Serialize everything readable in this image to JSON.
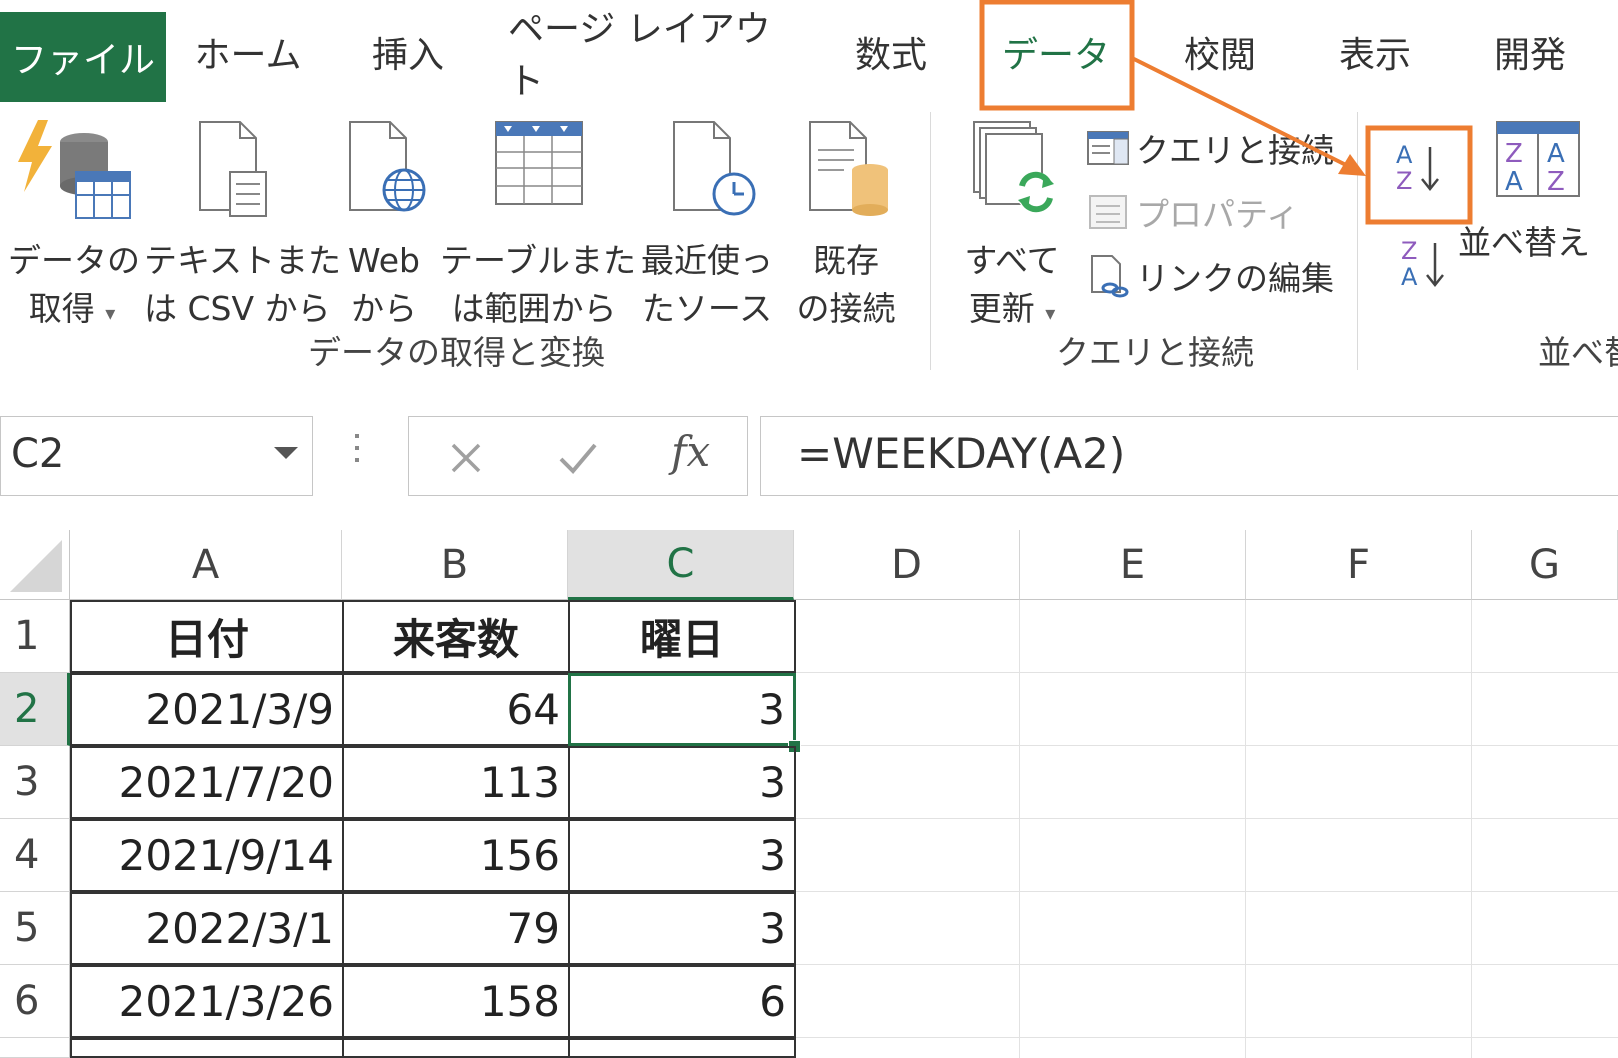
{
  "tabs": [
    "ファイル",
    "ホーム",
    "挿入",
    "ページ レイアウト",
    "数式",
    "データ",
    "校閲",
    "表示",
    "開発"
  ],
  "ribbon": {
    "get_data": {
      "line1": "データの",
      "line2": "取得"
    },
    "text_csv": {
      "line1": "テキストまた",
      "line2": "は CSV から"
    },
    "web": {
      "line1": "Web",
      "line2": "から"
    },
    "table_range": {
      "line1": "テーブルまた",
      "line2": "は範囲から"
    },
    "recent_sources": {
      "line1": "最近使っ",
      "line2": "たソース"
    },
    "existing_conn": {
      "line1": "既存",
      "line2": "の接続"
    },
    "refresh_all": {
      "line1": "すべて",
      "line2": "更新"
    },
    "queries_conn": "クエリと接続",
    "properties": "プロパティ",
    "edit_links": "リンクの編集",
    "sort": "並べ替え",
    "group_get_transform": "データの取得と変換",
    "group_queries": "クエリと接続",
    "group_sort": "並べ替",
    "sort_asc_letters": [
      "A",
      "Z"
    ],
    "sort_desc_letters": [
      "Z",
      "A"
    ],
    "sort_dialog_letters": [
      "Z",
      "A",
      "A",
      "Z"
    ]
  },
  "formula_bar": {
    "name_box": "C2",
    "formula": "=WEEKDAY(A2)",
    "fx": "fx"
  },
  "grid": {
    "columns": [
      "A",
      "B",
      "C",
      "D",
      "E",
      "F",
      "G"
    ],
    "rows": [
      "1",
      "2",
      "3",
      "4",
      "5",
      "6"
    ],
    "headers": [
      "日付",
      "来客数",
      "曜日"
    ],
    "data": [
      [
        "2021/3/9",
        "64",
        "3"
      ],
      [
        "2021/7/20",
        "113",
        "3"
      ],
      [
        "2021/9/14",
        "156",
        "3"
      ],
      [
        "2022/3/1",
        "79",
        "3"
      ],
      [
        "2021/3/26",
        "158",
        "6"
      ]
    ],
    "selected_cell": "C2"
  },
  "colors": {
    "excel_green": "#217346",
    "highlight_orange": "#ED7D31"
  }
}
